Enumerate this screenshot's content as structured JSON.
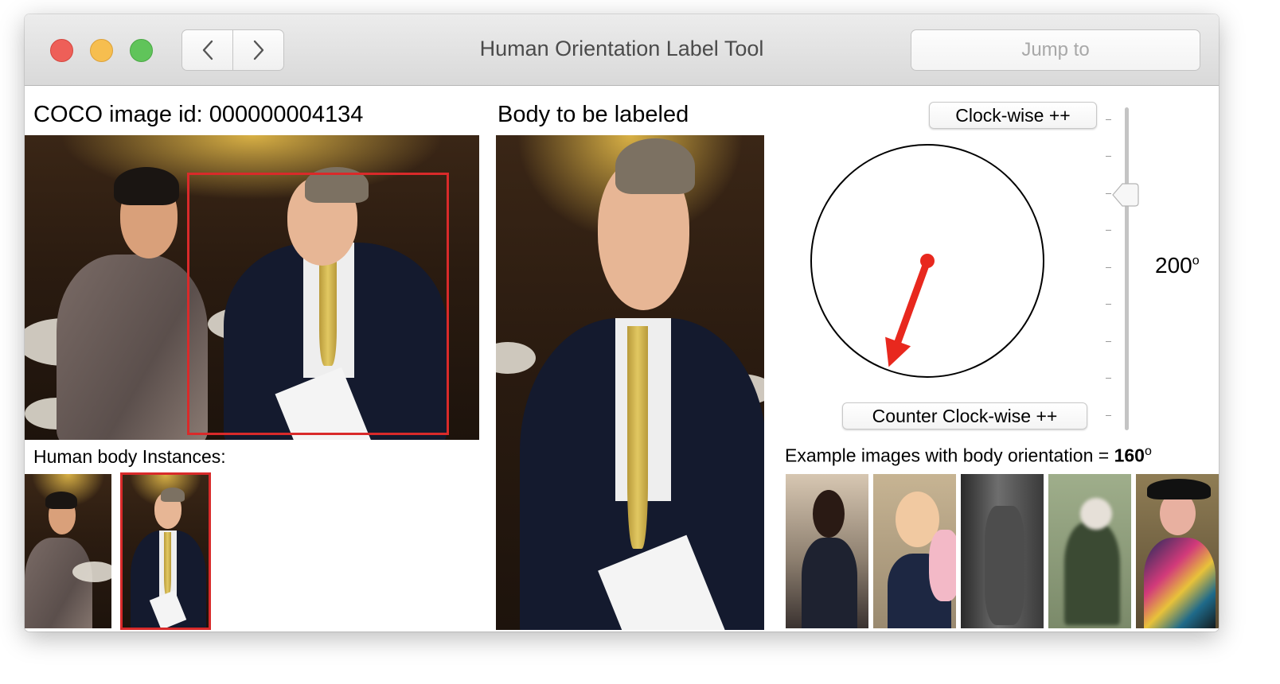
{
  "window": {
    "title": "Human Orientation Label Tool",
    "back_icon": "chevron-left-icon",
    "forward_icon": "chevron-right-icon",
    "jump_label": "Jump to"
  },
  "left_panel": {
    "image_id_label": "COCO image id: 000000004134",
    "instances_label": "Human body Instances:",
    "instance_count": 2,
    "selected_instance": 2
  },
  "middle_panel": {
    "title": "Body to be labeled"
  },
  "orientation": {
    "clockwise_label": "Clock-wise ++",
    "counter_clockwise_label": "Counter Clock-wise ++",
    "degree_value": "200",
    "degree_unit": "o",
    "angle_degrees": 200,
    "arrow_color": "#e8281e"
  },
  "examples": {
    "label_prefix": "Example images with body orientation = ",
    "orientation_value": "160",
    "orientation_unit": "o",
    "count": 5
  }
}
